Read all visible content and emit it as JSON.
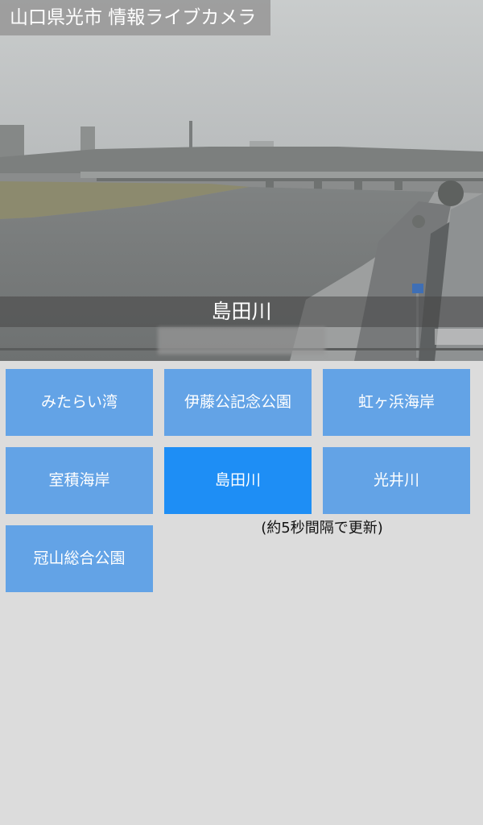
{
  "app": {
    "title": "山口県光市 情報ライブカメラ"
  },
  "camera": {
    "location_label": "島田川",
    "timestamp": ""
  },
  "buttons": [
    {
      "label": "みたらい湾",
      "active": false
    },
    {
      "label": "伊藤公記念公園",
      "active": false
    },
    {
      "label": "虹ヶ浜海岸",
      "active": false
    },
    {
      "label": "室積海岸",
      "active": false
    },
    {
      "label": "島田川",
      "active": true
    },
    {
      "label": "光井川",
      "active": false
    },
    {
      "label": "冠山総合公園",
      "active": false
    }
  ],
  "refresh_note": "(約5秒間隔で更新)",
  "colors": {
    "button": "#63a3e6",
    "button_active": "#1e8ef5",
    "background": "#dcdcdc"
  }
}
